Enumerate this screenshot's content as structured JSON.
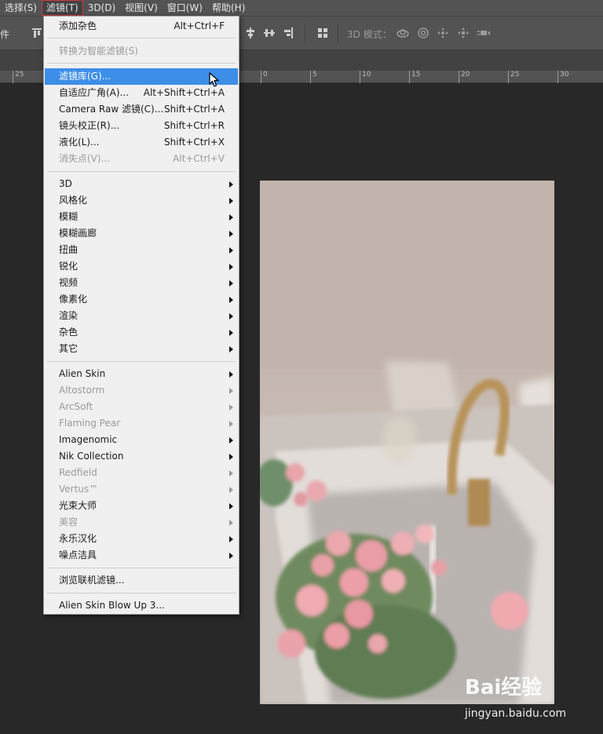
{
  "menubar": {
    "items": [
      "选择(S)",
      "滤镜(T)",
      "3D(D)",
      "视图(V)",
      "窗口(W)",
      "帮助(H)"
    ],
    "active_index": 1
  },
  "options_bar": {
    "left_label": "件",
    "mode_label": "3D 模式："
  },
  "ruler": {
    "labels": [
      "25",
      "0",
      "5",
      "10",
      "15",
      "20",
      "25",
      "30"
    ]
  },
  "filter_menu": {
    "items": [
      {
        "label": "添加杂色",
        "shortcut": "Alt+Ctrl+F"
      },
      {
        "label": "转换为智能滤镜(S)",
        "disabled": true
      },
      {
        "label": "滤镜库(G)...",
        "highlight": true
      },
      {
        "label": "自适应广角(A)...",
        "shortcut": "Alt+Shift+Ctrl+A"
      },
      {
        "label": "Camera Raw 滤镜(C)...",
        "shortcut": "Shift+Ctrl+A"
      },
      {
        "label": "镜头校正(R)...",
        "shortcut": "Shift+Ctrl+R"
      },
      {
        "label": "液化(L)...",
        "shortcut": "Shift+Ctrl+X"
      },
      {
        "label": "消失点(V)...",
        "shortcut": "Alt+Ctrl+V",
        "disabled": true
      },
      {
        "label": "3D",
        "submenu": true
      },
      {
        "label": "风格化",
        "submenu": true
      },
      {
        "label": "模糊",
        "submenu": true
      },
      {
        "label": "模糊画廊",
        "submenu": true
      },
      {
        "label": "扭曲",
        "submenu": true
      },
      {
        "label": "锐化",
        "submenu": true
      },
      {
        "label": "视频",
        "submenu": true
      },
      {
        "label": "像素化",
        "submenu": true
      },
      {
        "label": "渲染",
        "submenu": true
      },
      {
        "label": "杂色",
        "submenu": true
      },
      {
        "label": "其它",
        "submenu": true
      },
      {
        "label": "Alien Skin",
        "submenu": true
      },
      {
        "label": "Altostorm",
        "submenu": true,
        "disabled": true
      },
      {
        "label": "ArcSoft",
        "submenu": true,
        "disabled": true
      },
      {
        "label": "Flaming Pear",
        "submenu": true,
        "disabled": true
      },
      {
        "label": "Imagenomic",
        "submenu": true
      },
      {
        "label": "Nik Collection",
        "submenu": true
      },
      {
        "label": "Redfield",
        "submenu": true,
        "disabled": true
      },
      {
        "label": "Vertus™",
        "submenu": true,
        "disabled": true
      },
      {
        "label": "光束大师",
        "submenu": true
      },
      {
        "label": "美容",
        "submenu": true,
        "disabled": true
      },
      {
        "label": "永乐汉化",
        "submenu": true
      },
      {
        "label": "噪点洁具",
        "submenu": true
      },
      {
        "label": "浏览联机滤镜..."
      },
      {
        "label": "Alien Skin Blow Up 3..."
      }
    ]
  },
  "watermark": {
    "brand": "Bai经验",
    "url": "jingyan.baidu.com"
  },
  "colors": {
    "highlight": "#3d8ee8",
    "menu_bg": "#f0f0f0",
    "panel_bg": "#535353",
    "workspace_bg": "#282828"
  }
}
